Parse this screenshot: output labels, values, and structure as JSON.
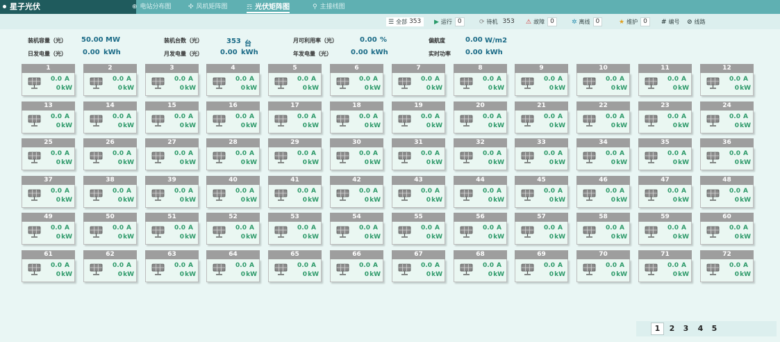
{
  "app": {
    "title": "星子光伏"
  },
  "nav": {
    "tabs": [
      {
        "label": "电站分布图",
        "icon": "globe-icon"
      },
      {
        "label": "风机矩阵图",
        "icon": "fan-icon"
      },
      {
        "label": "光伏矩阵图",
        "icon": "solar-icon",
        "active": true
      },
      {
        "label": "主接线图",
        "icon": "wiring-icon"
      }
    ]
  },
  "status": {
    "all": {
      "label": "全部",
      "count": "353"
    },
    "running": {
      "label": "运行",
      "count": "0"
    },
    "standby": {
      "label": "待机",
      "count": "353"
    },
    "fault": {
      "label": "故障",
      "count": "0"
    },
    "offline": {
      "label": "离线",
      "count": "0"
    },
    "maintenance": {
      "label": "维护",
      "count": "0"
    },
    "number": {
      "label": "编号"
    },
    "route": {
      "label": "线路"
    }
  },
  "summary": {
    "capacity": {
      "label": "装机容量（光）",
      "value": "50.00",
      "unit": "MW"
    },
    "units": {
      "label": "装机台数（光）",
      "value": "353",
      "unit": "台"
    },
    "monthly_util": {
      "label": "月可利用率（光）",
      "value": "0.00",
      "unit": "%"
    },
    "deviation": {
      "label": "偏航度",
      "value": "0.00",
      "unit": "W/m2"
    },
    "daily_energy": {
      "label": "日发电量（光）",
      "value": "0.00",
      "unit": "kWh"
    },
    "monthly_energy": {
      "label": "月发电量（光）",
      "value": "0.00",
      "unit": "kWh"
    },
    "yearly_energy": {
      "label": "年发电量（光）",
      "value": "0.00",
      "unit": "kWh"
    },
    "realtime_power": {
      "label": "实时功率",
      "value": "0.00",
      "unit": "kWh"
    }
  },
  "units": {
    "current": "A",
    "power": "kW"
  },
  "cards": [
    {
      "id": "1",
      "current": "0.0",
      "power": "0"
    },
    {
      "id": "2",
      "current": "0.0",
      "power": "0"
    },
    {
      "id": "3",
      "current": "0.0",
      "power": "0"
    },
    {
      "id": "4",
      "current": "0.0",
      "power": "0"
    },
    {
      "id": "5",
      "current": "0.0",
      "power": "0"
    },
    {
      "id": "6",
      "current": "0.0",
      "power": "0"
    },
    {
      "id": "7",
      "current": "0.0",
      "power": "0"
    },
    {
      "id": "8",
      "current": "0.0",
      "power": "0"
    },
    {
      "id": "9",
      "current": "0.0",
      "power": "0"
    },
    {
      "id": "10",
      "current": "0.0",
      "power": "0"
    },
    {
      "id": "11",
      "current": "0.0",
      "power": "0"
    },
    {
      "id": "12",
      "current": "0.0",
      "power": "0"
    },
    {
      "id": "13",
      "current": "0.0",
      "power": "0"
    },
    {
      "id": "14",
      "current": "0.0",
      "power": "0"
    },
    {
      "id": "15",
      "current": "0.0",
      "power": "0"
    },
    {
      "id": "16",
      "current": "0.0",
      "power": "0"
    },
    {
      "id": "17",
      "current": "0.0",
      "power": "0"
    },
    {
      "id": "18",
      "current": "0.0",
      "power": "0"
    },
    {
      "id": "19",
      "current": "0.0",
      "power": "0"
    },
    {
      "id": "20",
      "current": "0.0",
      "power": "0"
    },
    {
      "id": "21",
      "current": "0.0",
      "power": "0"
    },
    {
      "id": "22",
      "current": "0.0",
      "power": "0"
    },
    {
      "id": "23",
      "current": "0.0",
      "power": "0"
    },
    {
      "id": "24",
      "current": "0.0",
      "power": "0"
    },
    {
      "id": "25",
      "current": "0.0",
      "power": "0"
    },
    {
      "id": "26",
      "current": "0.0",
      "power": "0"
    },
    {
      "id": "27",
      "current": "0.0",
      "power": "0"
    },
    {
      "id": "28",
      "current": "0.0",
      "power": "0"
    },
    {
      "id": "29",
      "current": "0.0",
      "power": "0"
    },
    {
      "id": "30",
      "current": "0.0",
      "power": "0"
    },
    {
      "id": "31",
      "current": "0.0",
      "power": "0"
    },
    {
      "id": "32",
      "current": "0.0",
      "power": "0"
    },
    {
      "id": "33",
      "current": "0.0",
      "power": "0"
    },
    {
      "id": "34",
      "current": "0.0",
      "power": "0"
    },
    {
      "id": "35",
      "current": "0.0",
      "power": "0"
    },
    {
      "id": "36",
      "current": "0.0",
      "power": "0"
    },
    {
      "id": "37",
      "current": "0.0",
      "power": "0"
    },
    {
      "id": "38",
      "current": "0.0",
      "power": "0"
    },
    {
      "id": "39",
      "current": "0.0",
      "power": "0"
    },
    {
      "id": "40",
      "current": "0.0",
      "power": "0"
    },
    {
      "id": "41",
      "current": "0.0",
      "power": "0"
    },
    {
      "id": "42",
      "current": "0.0",
      "power": "0"
    },
    {
      "id": "43",
      "current": "0.0",
      "power": "0"
    },
    {
      "id": "44",
      "current": "0.0",
      "power": "0"
    },
    {
      "id": "45",
      "current": "0.0",
      "power": "0"
    },
    {
      "id": "46",
      "current": "0.0",
      "power": "0"
    },
    {
      "id": "47",
      "current": "0.0",
      "power": "0"
    },
    {
      "id": "48",
      "current": "0.0",
      "power": "0"
    },
    {
      "id": "49",
      "current": "0.0",
      "power": "0"
    },
    {
      "id": "50",
      "current": "0.0",
      "power": "0"
    },
    {
      "id": "51",
      "current": "0.0",
      "power": "0"
    },
    {
      "id": "52",
      "current": "0.0",
      "power": "0"
    },
    {
      "id": "53",
      "current": "0.0",
      "power": "0"
    },
    {
      "id": "54",
      "current": "0.0",
      "power": "0"
    },
    {
      "id": "55",
      "current": "0.0",
      "power": "0"
    },
    {
      "id": "56",
      "current": "0.0",
      "power": "0"
    },
    {
      "id": "57",
      "current": "0.0",
      "power": "0"
    },
    {
      "id": "58",
      "current": "0.0",
      "power": "0"
    },
    {
      "id": "59",
      "current": "0.0",
      "power": "0"
    },
    {
      "id": "60",
      "current": "0.0",
      "power": "0"
    },
    {
      "id": "61",
      "current": "0.0",
      "power": "0"
    },
    {
      "id": "62",
      "current": "0.0",
      "power": "0"
    },
    {
      "id": "63",
      "current": "0.0",
      "power": "0"
    },
    {
      "id": "64",
      "current": "0.0",
      "power": "0"
    },
    {
      "id": "65",
      "current": "0.0",
      "power": "0"
    },
    {
      "id": "66",
      "current": "0.0",
      "power": "0"
    },
    {
      "id": "67",
      "current": "0.0",
      "power": "0"
    },
    {
      "id": "68",
      "current": "0.0",
      "power": "0"
    },
    {
      "id": "69",
      "current": "0.0",
      "power": "0"
    },
    {
      "id": "70",
      "current": "0.0",
      "power": "0"
    },
    {
      "id": "71",
      "current": "0.0",
      "power": "0"
    },
    {
      "id": "72",
      "current": "0.0",
      "power": "0"
    }
  ],
  "pagination": {
    "pages": [
      "1",
      "2",
      "3",
      "4",
      "5"
    ],
    "current": "1"
  },
  "colors": {
    "header": "#5fb0b2",
    "brand": "#1f5b5d",
    "card_head": "#9e9e9e",
    "value_green": "#2e9a6a",
    "summary_blue": "#1a6a86"
  }
}
